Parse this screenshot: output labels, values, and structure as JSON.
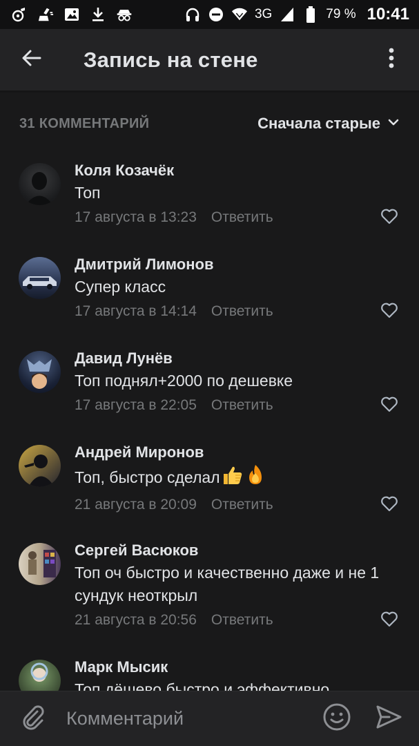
{
  "status_bar": {
    "network": "3G",
    "battery": "79 %",
    "time": "10:41"
  },
  "header": {
    "title": "Запись на стене",
    "back_icon": "arrow-left-icon",
    "more_icon": "more-vertical-icon"
  },
  "comments_header": {
    "count_label": "31 КОММЕНТАРИЙ",
    "sort_label": "Сначала старые"
  },
  "comments": [
    {
      "author": "Коля Козачёк",
      "text": "Топ",
      "date": "17 августа в 13:23",
      "reply": "Ответить",
      "avatar_colors": [
        "#2b2c2e",
        "#141517"
      ]
    },
    {
      "author": "Дмитрий Лимонов",
      "text": "Супер класс",
      "date": "17 августа в 14:14",
      "reply": "Ответить",
      "avatar_colors": [
        "#4a5a7a",
        "#1c2436"
      ]
    },
    {
      "author": "Давид Лунёв",
      "text": "Топ поднял+2000 по дешевке",
      "date": "17 августа в 22:05",
      "reply": "Ответить",
      "avatar_colors": [
        "#3a4a66",
        "#111a2a"
      ]
    },
    {
      "author": "Андрей Миронов",
      "text": "Топ, быстро сделал",
      "text_emojis": [
        "thumbs-up-emoji",
        "fire-emoji"
      ],
      "date": "21 августа в 20:09",
      "reply": "Ответить",
      "avatar_colors": [
        "#b89a3c",
        "#2a2a3a"
      ]
    },
    {
      "author": "Сергей Васюков",
      "text": "Топ оч быстро и качественно даже и не 1 сундук неоткрыл",
      "date": "21 августа в 20:56",
      "reply": "Ответить",
      "avatar_colors": [
        "#cfc3b0",
        "#5a4a3a"
      ]
    },
    {
      "author": "Марк Мысик",
      "text": "Топ дёшево быстро и эффективно",
      "date": "",
      "reply": "",
      "avatar_colors": [
        "#6b8a5a",
        "#2a3a2a"
      ]
    }
  ],
  "composer": {
    "placeholder": "Комментарий",
    "attach_icon": "paperclip-icon",
    "emoji_icon": "smiley-icon",
    "send_icon": "send-icon"
  },
  "colors": {
    "background": "#19191a",
    "app_bar": "#232325",
    "primary_text": "#e1e3e6",
    "secondary_text": "#76787a"
  }
}
